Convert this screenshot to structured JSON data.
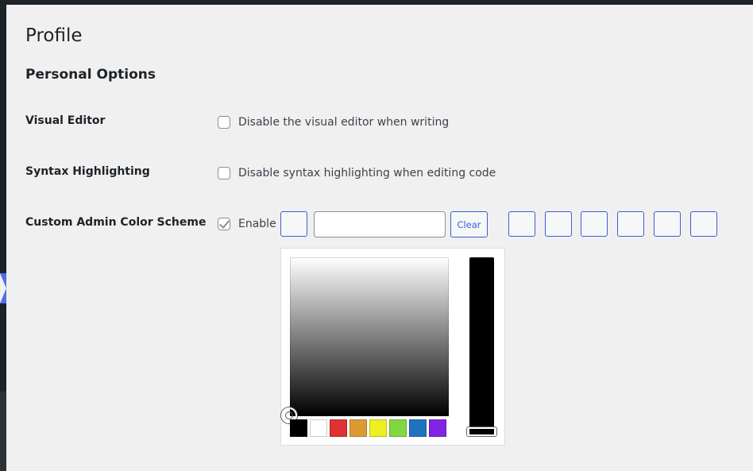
{
  "page": {
    "title": "Profile",
    "section_title": "Personal Options"
  },
  "rows": {
    "visual_editor": {
      "label": "Visual Editor",
      "option": "Disable the visual editor when writing",
      "checked": false
    },
    "syntax_highlighting": {
      "label": "Syntax Highlighting",
      "option": "Disable syntax highlighting when editing code",
      "checked": false
    },
    "color_scheme": {
      "label": "Custom Admin Color Scheme",
      "option": "Enable",
      "checked": true,
      "hex_value": "",
      "clear_label": "Clear"
    }
  },
  "picker": {
    "palette": [
      "#000000",
      "#ffffff",
      "#dd3333",
      "#dd9933",
      "#eeee22",
      "#81d742",
      "#1e73be",
      "#8224e3"
    ],
    "selected_color": "#000000"
  },
  "colors": {
    "accent": "#3c5ed9",
    "admin_menu": "#1d2327",
    "menu_highlight": "#4f6ee9",
    "background": "#f0f0f1"
  }
}
